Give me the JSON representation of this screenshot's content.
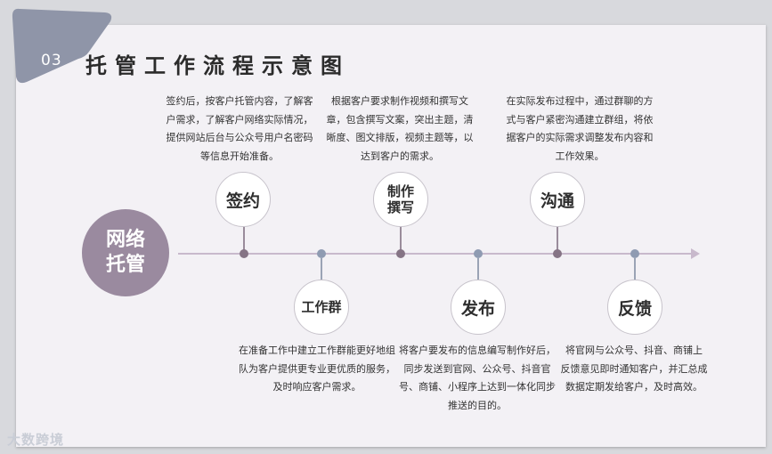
{
  "header": {
    "section_number": "03",
    "title": "托管工作流程示意图"
  },
  "center_node": {
    "label_line1": "网络",
    "label_line2": "托管"
  },
  "steps": [
    {
      "label": "签约",
      "description": "签约后，按客户托管内容，了解客户需求，了解客户网络实际情况，提供网站后台与公众号用户名密码等信息开始准备。"
    },
    {
      "label": "工作群",
      "description": "在准备工作中建立工作群能更好地组队为客户提供更专业更优质的服务，及时响应客户需求。"
    },
    {
      "label_line1": "制作",
      "label_line2": "撰写",
      "description": "根据客户要求制作视频和撰写文章，包含撰写文案，突出主题，清晰度、图文排版，视频主题等，以达到客户的需求。"
    },
    {
      "label": "发布",
      "description": "将客户要发布的信息编写制作好后，同步发送到官网、公众号、抖音官号、商铺、小程序上达到一体化同步推送的目的。"
    },
    {
      "label": "沟通",
      "description": "在实际发布过程中，通过群聊的方式与客户紧密沟通建立群组，将依据客户的实际需求调整发布内容和工作效果。"
    },
    {
      "label": "反馈",
      "description": "将官网与公众号、抖音、商铺上 反馈意见即时通知客户，并汇总成数据定期发给客户，及时高效。"
    }
  ],
  "watermark": "大数跨境",
  "colors": {
    "accent": "#9a8a9f",
    "tab": "#8f95a8",
    "timeline": "#c8b9cc"
  }
}
